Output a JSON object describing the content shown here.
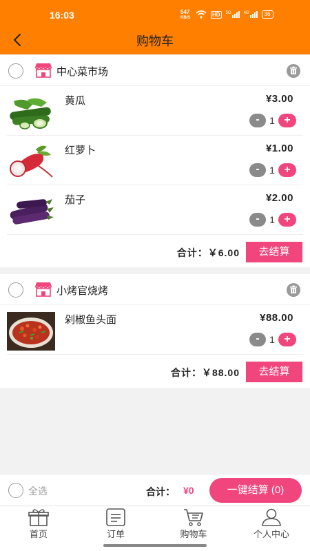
{
  "status_bar": {
    "time": "16:03",
    "net_speed": "547",
    "net_unit": "KB/S",
    "hd": "HD",
    "signal_1": "5G",
    "signal_2": "4G",
    "battery": "36"
  },
  "header": {
    "title": "购物车"
  },
  "shops": [
    {
      "name": "中心菜市场",
      "items": [
        {
          "name": "黄瓜",
          "price": "¥3.00",
          "qty": "1",
          "image": "cucumber-image"
        },
        {
          "name": "红萝卜",
          "price": "¥1.00",
          "qty": "1",
          "image": "radish-image"
        },
        {
          "name": "茄子",
          "price": "¥2.00",
          "qty": "1",
          "image": "eggplant-image"
        }
      ],
      "subtotal": "合计：￥6.00",
      "checkout_label": "去结算"
    },
    {
      "name": "小烤官烧烤",
      "items": [
        {
          "name": "剁椒鱼头面",
          "price": "¥88.00",
          "qty": "1",
          "image": "fish-head-image"
        }
      ],
      "subtotal": "合计：￥88.00",
      "checkout_label": "去结算"
    }
  ],
  "stepper": {
    "minus": "-",
    "plus": "+"
  },
  "bottom_bar": {
    "select_all": "全选",
    "total_label": "合计：",
    "total_value": "¥0",
    "checkout_all": "一键结算 (0)"
  },
  "tabs": [
    {
      "label": "首页",
      "icon": "gift-icon"
    },
    {
      "label": "订单",
      "icon": "order-icon"
    },
    {
      "label": "购物车",
      "icon": "cart-icon"
    },
    {
      "label": "个人中心",
      "icon": "profile-icon"
    }
  ],
  "colors": {
    "header": "#ff7f00",
    "accent": "#f0457d",
    "minus": "#8a8a8a"
  }
}
